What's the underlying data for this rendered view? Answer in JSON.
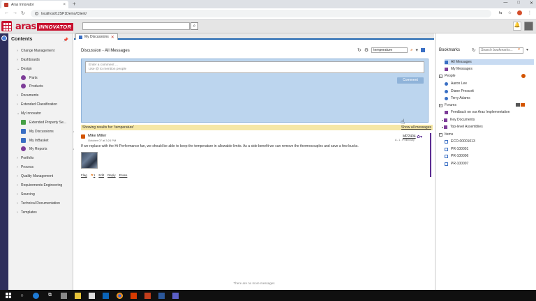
{
  "browser": {
    "tab_title": "Aras Innovator",
    "url": "localhost/12SP1Demo/Client/"
  },
  "app": {
    "logo_left": "aras",
    "logo_right": "INNOVATOR"
  },
  "sidebar": {
    "title": "Contents",
    "items": [
      {
        "label": "Change Management",
        "chev": "›"
      },
      {
        "label": "Dashboards",
        "chev": "›"
      },
      {
        "label": "Design",
        "chev": "⌄"
      },
      {
        "label": "Parts",
        "chev": ""
      },
      {
        "label": "Products",
        "chev": ""
      },
      {
        "label": "Documents",
        "chev": "›"
      },
      {
        "label": "Extended Classification",
        "chev": "›"
      },
      {
        "label": "My Innovator",
        "chev": "⌄"
      },
      {
        "label": "Extended Property Se...",
        "chev": ""
      },
      {
        "label": "My Discussions",
        "chev": ""
      },
      {
        "label": "My InBasket",
        "chev": ""
      },
      {
        "label": "My Reports",
        "chev": ""
      },
      {
        "label": "Portfolio",
        "chev": "›"
      },
      {
        "label": "Process",
        "chev": "›"
      },
      {
        "label": "Quality Management",
        "chev": "›"
      },
      {
        "label": "Requirements Engineering",
        "chev": "›"
      },
      {
        "label": "Sourcing",
        "chev": "›"
      },
      {
        "label": "Technical Documentation",
        "chev": "›"
      },
      {
        "label": "Templates",
        "chev": "›"
      }
    ]
  },
  "main": {
    "tab_label": "My Discussions",
    "tab_close": "✕",
    "title": "Discussion - All Messages",
    "search_value": "temperature",
    "comment_placeholder_1": "Enter a comment ...",
    "comment_placeholder_2": "Use @ to mention people",
    "comment_button": "Comment",
    "results_text": "Showing results for: 'temperature'",
    "show_all": "Show all messages",
    "post": {
      "author": "Mike Miller",
      "date": "October 07 at 3:24 PM",
      "item": "MP2404",
      "version": "A - 1 - Preliminary",
      "body": "If we replace with the Hi-Performance fan, we should be able to keep the temperature in allowable limits.  As a side benefit we can remove the thermocouples and save a few bucks.",
      "actions": {
        "flag": "Flag",
        "count": "1",
        "edit": "Edit",
        "reply": "Reply",
        "erase": "Erase"
      }
    },
    "no_more": "There are no more messages"
  },
  "bookmarks": {
    "title": "Bookmarks",
    "search_placeholder": "Search bookmarks...",
    "all_messages": "All Messages",
    "my_messages": "My Messages",
    "people_label": "People",
    "people": [
      "Aaron Lee",
      "Diane Prescott",
      "Terry Adams"
    ],
    "forums_label": "Forums",
    "forums": [
      "Feedback on our Aras Implementation",
      "Key Documents",
      "Top-level Assemblies"
    ],
    "items_label": "Items",
    "items": [
      "ECO-00001013",
      "PR-100001",
      "PR-100006",
      "PR-100007"
    ]
  }
}
